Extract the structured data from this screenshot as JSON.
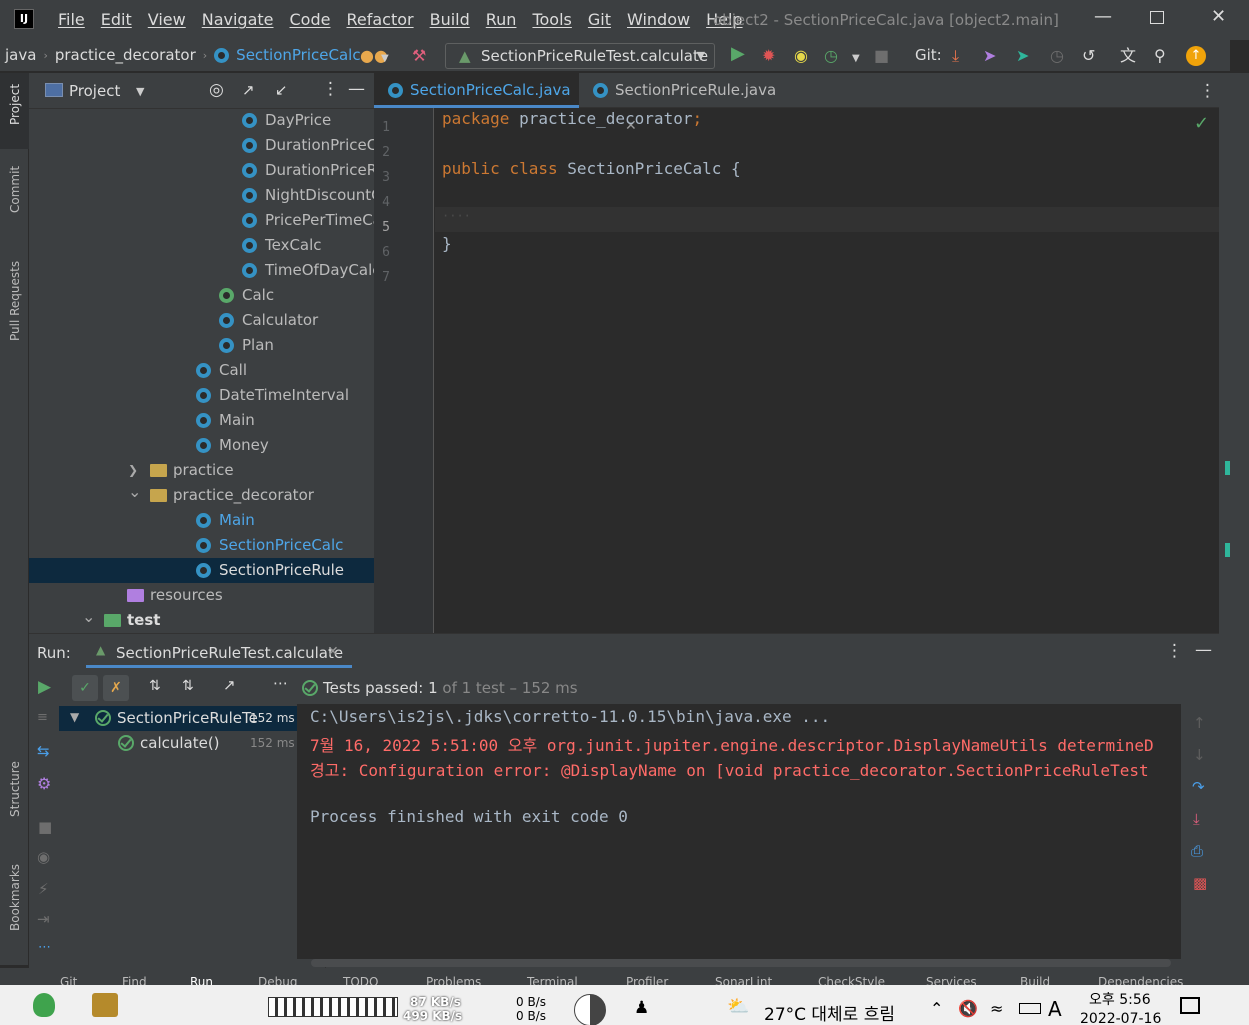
{
  "menubar": {
    "items": [
      "File",
      "Edit",
      "View",
      "Navigate",
      "Code",
      "Refactor",
      "Build",
      "Run",
      "Tools",
      "Git",
      "Window",
      "Help"
    ],
    "window_title": "object2 - SectionPriceCalc.java [object2.main]"
  },
  "breadcrumbs": [
    "java",
    "practice_decorator",
    "SectionPriceCalc"
  ],
  "run_config": "SectionPriceRuleTest.calculate",
  "git_label": "Git:",
  "left_stripe": {
    "project": "Project",
    "commit": "Commit",
    "pull_requests": "Pull Requests",
    "structure": "Structure",
    "bookmarks": "Bookmarks"
  },
  "project_panel": {
    "title": "Project",
    "tree": [
      {
        "label": "DayPrice",
        "indent": 3,
        "icon": "class"
      },
      {
        "label": "DurationPriceCal",
        "indent": 3,
        "icon": "class"
      },
      {
        "label": "DurationPriceRul",
        "indent": 3,
        "icon": "class"
      },
      {
        "label": "NightDiscountCa",
        "indent": 3,
        "icon": "class"
      },
      {
        "label": "PricePerTimeCalc",
        "indent": 3,
        "icon": "class"
      },
      {
        "label": "TexCalc",
        "indent": 3,
        "icon": "class"
      },
      {
        "label": "TimeOfDayCalc",
        "indent": 3,
        "icon": "class"
      },
      {
        "label": "Calc",
        "indent": 2,
        "icon": "interface"
      },
      {
        "label": "Calculator",
        "indent": 2,
        "icon": "class"
      },
      {
        "label": "Plan",
        "indent": 2,
        "icon": "class"
      },
      {
        "label": "Call",
        "indent": 1,
        "icon": "class"
      },
      {
        "label": "DateTimeInterval",
        "indent": 1,
        "icon": "class"
      },
      {
        "label": "Main",
        "indent": 1,
        "icon": "class"
      },
      {
        "label": "Money",
        "indent": 1,
        "icon": "class"
      },
      {
        "label": "practice",
        "indent": 0,
        "icon": "folder",
        "arrow": "collapsed"
      },
      {
        "label": "practice_decorator",
        "indent": 0,
        "icon": "folder",
        "arrow": "expanded"
      },
      {
        "label": "Main",
        "indent": 1,
        "icon": "class",
        "color": "#4ea6e8"
      },
      {
        "label": "SectionPriceCalc",
        "indent": 1,
        "icon": "class",
        "color": "#4ea6e8"
      },
      {
        "label": "SectionPriceRule",
        "indent": 1,
        "icon": "class",
        "selected": true
      },
      {
        "label": "resources",
        "indent": -1,
        "icon": "resources"
      },
      {
        "label": "test",
        "indent": -2,
        "icon": "test-folder",
        "arrow": "expanded",
        "bold": true
      }
    ]
  },
  "editor": {
    "tabs": [
      {
        "label": "SectionPriceCalc.java",
        "active": true
      },
      {
        "label": "SectionPriceRule.java",
        "active": false
      }
    ],
    "line_numbers": [
      "1",
      "2",
      "3",
      "4",
      "5",
      "6",
      "7"
    ],
    "code": {
      "line1_kw": "package",
      "line1_rest": " practice_decorator",
      "line1_semi": ";",
      "line3_kw1": "public",
      "line3_kw2": "class",
      "line3_rest": " SectionPriceCalc {",
      "line5": "····",
      "line6": "}"
    }
  },
  "run_panel": {
    "label": "Run:",
    "tab": "SectionPriceRuleTest.calculate",
    "status": "Tests passed:",
    "passed_count": "1",
    "status_rest": "of 1 test – 152 ms",
    "tests": [
      {
        "label": "SectionPriceRuleTe",
        "time": "152 ms"
      },
      {
        "label": "calculate()",
        "time": "152 ms"
      }
    ],
    "console": [
      {
        "text": "C:\\Users\\is2js\\.jdks\\corretto-11.0.15\\bin\\java.exe ...",
        "color": "#a9b7c6"
      },
      {
        "text": "7월 16, 2022 5:51:00 오후 org.junit.jupiter.engine.descriptor.DisplayNameUtils determineD",
        "color": "#ff6b68"
      },
      {
        "text": "경고: Configuration error: @DisplayName on [void practice_decorator.SectionPriceRuleTest",
        "color": "#ff6b68"
      },
      {
        "text": "",
        "color": "#a9b7c6"
      },
      {
        "text": "Process finished with exit code 0",
        "color": "#a9b7c6"
      }
    ]
  },
  "bottom_tools": [
    "Git",
    "Find",
    "Run",
    "Debug",
    "TODO",
    "Problems",
    "Terminal",
    "Profiler",
    "SonarLint",
    "CheckStyle",
    "Services",
    "Build",
    "Dependencies"
  ],
  "taskbar": {
    "net_up": "87 KB/s",
    "net_down": "499 KB/s",
    "disk_up": "0 B/s",
    "disk_down": "0 B/s",
    "weather": "27°C 대체로 흐림",
    "ime": "A",
    "time": "오후 5:56",
    "date": "2022-07-16"
  }
}
